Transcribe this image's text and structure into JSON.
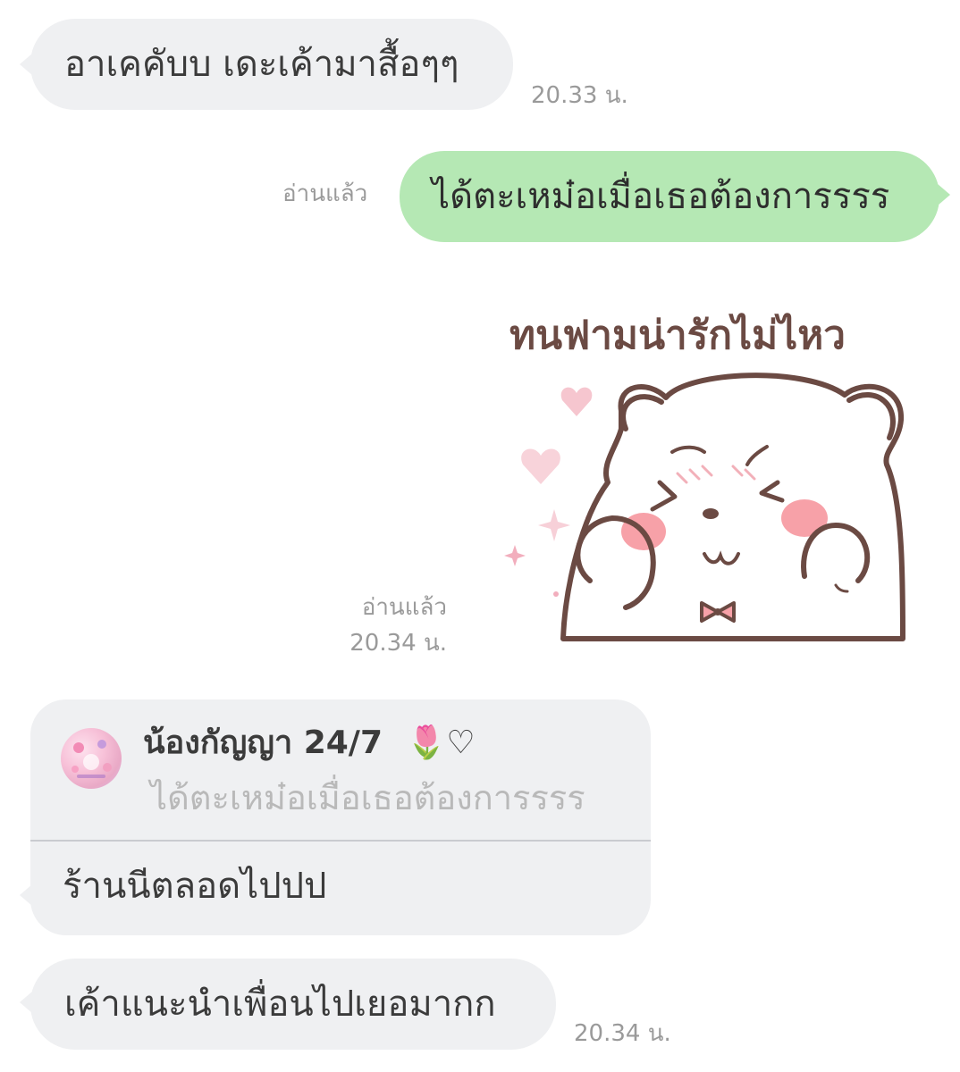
{
  "messages": {
    "m1": {
      "text": "อาเคคับบ เดะเค้ามาสื้อๆๆ",
      "time": "20.33 น."
    },
    "m2": {
      "text": "ได้ตะเหม๋อเมื่อเธอต้องการรรร",
      "read": "อ่านแล้ว"
    },
    "sticker": {
      "caption": "ทนฟามน่ารักไม่ไหว",
      "read": "อ่านแล้ว",
      "time": "20.34 น."
    },
    "reply": {
      "name": "น้องกัญญา 24/7",
      "name_suffix": "🌷♡",
      "quoted": "ได้ตะเหม๋อเมื่อเธอต้องการรรร",
      "text": "ร้านนีตลอดไปปป"
    },
    "m5": {
      "text": "เค้าแนะนำเพื่อนไปเยอมากก",
      "time": "20.34 น."
    }
  },
  "colors": {
    "incoming_bubble": "#eff0f2",
    "outgoing_bubble": "#b5e8b4",
    "meta_text": "#9a9a9a"
  },
  "icons": {
    "reply_avatar": "avatar",
    "sticker": "bear-blushing-sticker"
  }
}
